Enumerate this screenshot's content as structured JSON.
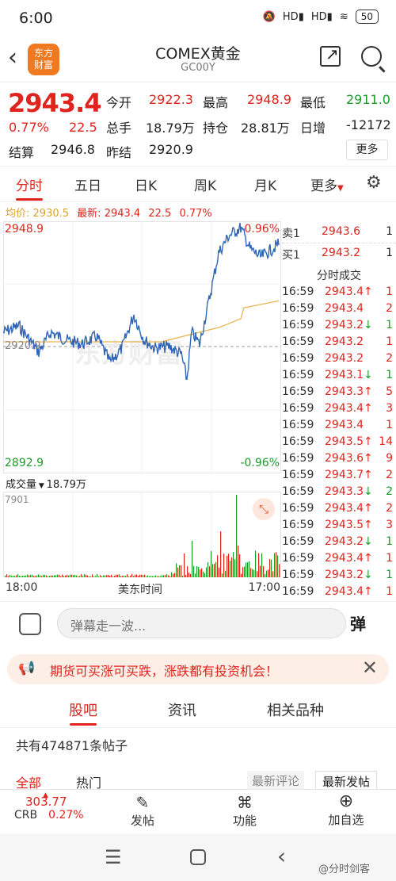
{
  "status_bar": {
    "time": "6:00",
    "battery": "50",
    "signal1": "HD",
    "signal2": "HD"
  },
  "header": {
    "logo_line1": "东方",
    "logo_line2": "财富",
    "title": "COMEX黄金",
    "code": "GC00Y"
  },
  "quote": {
    "price": "2943.4",
    "change_pct": "0.77%",
    "change": "22.5",
    "open_label": "今开",
    "open": "2922.3",
    "high_label": "最高",
    "high": "2948.9",
    "low_label": "最低",
    "low": "2911.0",
    "volume_label": "总手",
    "volume": "18.79万",
    "oi_label": "持仓",
    "oi": "28.81万",
    "daily_inc_label": "日增",
    "daily_inc": "-12172",
    "settle_label": "结算",
    "settle": "2946.8",
    "prev_settle_label": "昨结",
    "prev_settle": "2920.9",
    "more_label": "更多"
  },
  "tabs": [
    "分时",
    "五日",
    "日K",
    "周K",
    "月K",
    "更多"
  ],
  "avg_bar": {
    "avg_label": "均价:",
    "avg": "2930.5",
    "latest_label": "最新:",
    "latest": "2943.4",
    "chg": "22.5",
    "pct": "0.77%"
  },
  "chart": {
    "top_price": "2948.9",
    "top_pct": "0.96%",
    "bottom_price": "2892.9",
    "bottom_pct": "-0.96%",
    "mid_price": "2920.9",
    "watermark": "东方财富",
    "start_time": "18:00",
    "mid_label": "美东时间",
    "end_time": "17:00",
    "vol_label": "成交量",
    "vol_value": "18.79万",
    "vol_max": "7901"
  },
  "orderbook": {
    "sell_label": "卖1",
    "sell_price": "2943.6",
    "sell_vol": "1",
    "buy_label": "买1",
    "buy_price": "2943.2",
    "buy_vol": "1",
    "ticks_title": "分时成交"
  },
  "ticks": [
    {
      "time": "16:59",
      "price": "2943.4",
      "dir": "up",
      "vol": "1"
    },
    {
      "time": "16:59",
      "price": "2943.4",
      "dir": "none",
      "vol": "2"
    },
    {
      "time": "16:59",
      "price": "2943.2",
      "dir": "down",
      "vol": "1"
    },
    {
      "time": "16:59",
      "price": "2943.2",
      "dir": "none",
      "vol": "1"
    },
    {
      "time": "16:59",
      "price": "2943.2",
      "dir": "none",
      "vol": "2"
    },
    {
      "time": "16:59",
      "price": "2943.1",
      "dir": "down",
      "vol": "1"
    },
    {
      "time": "16:59",
      "price": "2943.3",
      "dir": "up",
      "vol": "5"
    },
    {
      "time": "16:59",
      "price": "2943.4",
      "dir": "up",
      "vol": "3"
    },
    {
      "time": "16:59",
      "price": "2943.4",
      "dir": "none",
      "vol": "1"
    },
    {
      "time": "16:59",
      "price": "2943.5",
      "dir": "up",
      "vol": "14"
    },
    {
      "time": "16:59",
      "price": "2943.6",
      "dir": "up",
      "vol": "9"
    },
    {
      "time": "16:59",
      "price": "2943.7",
      "dir": "up",
      "vol": "2"
    },
    {
      "time": "16:59",
      "price": "2943.3",
      "dir": "down",
      "vol": "2"
    },
    {
      "time": "16:59",
      "price": "2943.4",
      "dir": "up",
      "vol": "2"
    },
    {
      "time": "16:59",
      "price": "2943.5",
      "dir": "up",
      "vol": "3"
    },
    {
      "time": "16:59",
      "price": "2943.2",
      "dir": "down",
      "vol": "1"
    },
    {
      "time": "16:59",
      "price": "2943.4",
      "dir": "up",
      "vol": "1"
    },
    {
      "time": "16:59",
      "price": "2943.2",
      "dir": "down",
      "vol": "1"
    },
    {
      "time": "16:59",
      "price": "2943.4",
      "dir": "up",
      "vol": "1"
    }
  ],
  "danmu": {
    "placeholder": "弹幕走一波...",
    "btn": "弹"
  },
  "banner": {
    "text": "期货可买涨可买跌，涨跌都有投资机会！"
  },
  "subtabs": [
    "股吧",
    "资讯",
    "相关品种"
  ],
  "posts_count": "共有474871条帖子",
  "filters": {
    "all": "全部",
    "hot": "热门",
    "latest_comment": "最新评论",
    "latest_post": "最新发帖"
  },
  "bottom_bar": {
    "crb_value": "303.77",
    "crb_label": "CRB",
    "crb_pct": "0.27%",
    "post": "发帖",
    "func": "功能",
    "add": "加自选"
  },
  "nav": {
    "menu": "menu",
    "home": "home",
    "back": "back"
  },
  "watermark": "@分时剑客",
  "colors": {
    "up": "#e0231d",
    "down": "#1a9b2a",
    "price_line": "#3066b8",
    "avg_line": "#e8b24a",
    "accent": "#e0231d"
  }
}
